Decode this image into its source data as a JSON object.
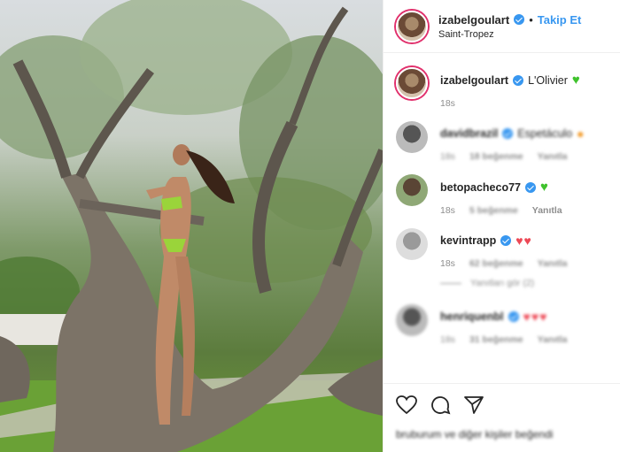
{
  "post": {
    "username": "izabelgoulart",
    "follow_label": "Takip Et",
    "location": "Saint-Tropez"
  },
  "caption": {
    "username": "izabelgoulart",
    "text": "L'Olivier",
    "time": "18s"
  },
  "comments": [
    {
      "username": "davidbrazil",
      "text": "Espetáculo",
      "time": "18s",
      "likes": "18 beğenme",
      "reply": "Yanıtla"
    },
    {
      "username": "betopacheco77",
      "text": "",
      "time": "18s",
      "likes": "5 beğenme",
      "reply": "Yanıtla"
    },
    {
      "username": "kevintrapp",
      "text": "",
      "time": "18s",
      "likes": "62 beğenme",
      "reply": "Yanıtla",
      "view_replies": "Yanıtları gör (2)"
    },
    {
      "username": "henriquenbl",
      "text": "",
      "time": "18s",
      "likes": "31 beğenme",
      "reply": "Yanıtla"
    }
  ],
  "likes_text": "bruburum ve diğer kişiler beğendi",
  "icons": [
    "heart-icon",
    "comment-icon",
    "share-icon"
  ],
  "colors": {
    "accent": "#3897f0",
    "green_heart": "#3fc22d",
    "red_heart": "#ed4956"
  }
}
